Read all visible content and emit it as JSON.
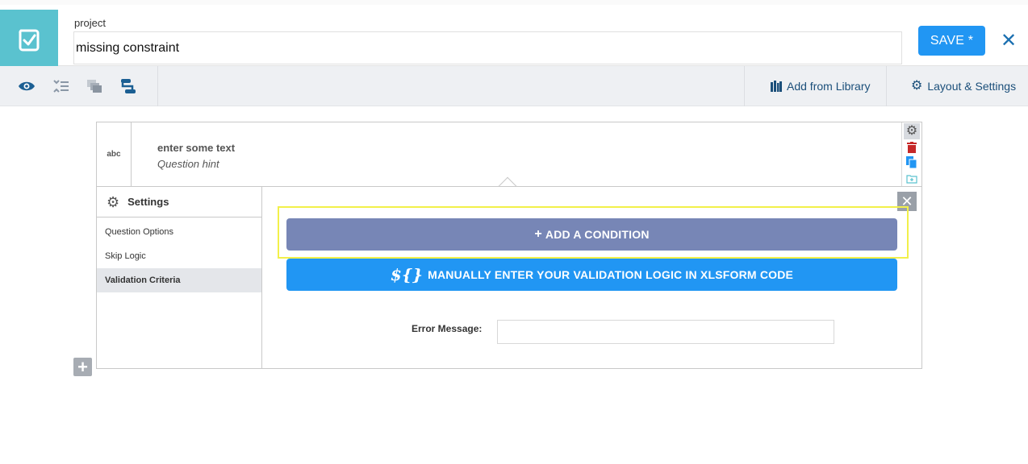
{
  "header": {
    "project_label": "project",
    "project_name": "missing constraint",
    "save_label": "SAVE *",
    "close_glyph": "✕"
  },
  "toolbar": {
    "icons": [
      "eye-icon",
      "collapse-icon",
      "group-icon",
      "skip-logic-icon"
    ],
    "add_from_library": "Add from Library",
    "layout_settings": "Layout & Settings"
  },
  "question": {
    "type": "abc",
    "label": "enter some text",
    "hint": "Question hint"
  },
  "settings": {
    "title": "Settings",
    "menu": [
      {
        "label": "Question Options",
        "active": false
      },
      {
        "label": "Skip Logic",
        "active": false
      },
      {
        "label": "Validation Criteria",
        "active": true
      }
    ],
    "add_condition": "ADD A CONDITION",
    "manual_glyph": "${}",
    "manual_entry": "MANUALLY ENTER YOUR VALIDATION LOGIC IN XLSFORM CODE",
    "error_message_label": "Error Message:",
    "error_message_value": ""
  },
  "colors": {
    "brand": "#5ac2cf",
    "primary": "#2196f3",
    "condition": "#7786b6",
    "highlight": "#f2f04a"
  }
}
